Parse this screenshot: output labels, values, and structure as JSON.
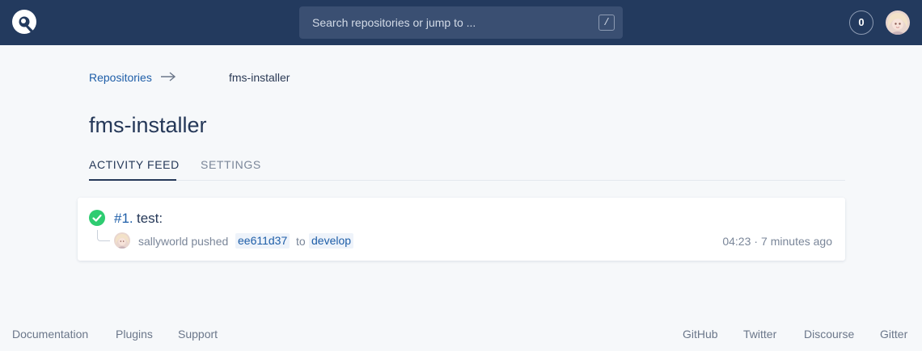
{
  "header": {
    "search_placeholder": "Search repositories or jump to ...",
    "search_shortcut": "/",
    "notification_count": "0"
  },
  "breadcrumb": {
    "parent": "Repositories",
    "current": "fms-installer"
  },
  "page": {
    "title": "fms-installer"
  },
  "tabs": [
    {
      "label": "ACTIVITY FEED",
      "active": true
    },
    {
      "label": "SETTINGS",
      "active": false
    }
  ],
  "builds": [
    {
      "number": "#1.",
      "message": "test:",
      "status": "success",
      "user": "sallyworld",
      "action": "pushed",
      "commit": "ee611d37",
      "to": "to",
      "branch": "develop",
      "duration": "04:23",
      "separator": "·",
      "ago": "7 minutes ago"
    }
  ],
  "footer": {
    "left": [
      "Documentation",
      "Plugins",
      "Support"
    ],
    "right": [
      "GitHub",
      "Twitter",
      "Discourse",
      "Gitter"
    ]
  },
  "colors": {
    "header_bg": "#233a5e",
    "accent_link": "#1e5ea8",
    "success": "#2ecc71",
    "page_bg": "#f6f8fa"
  }
}
